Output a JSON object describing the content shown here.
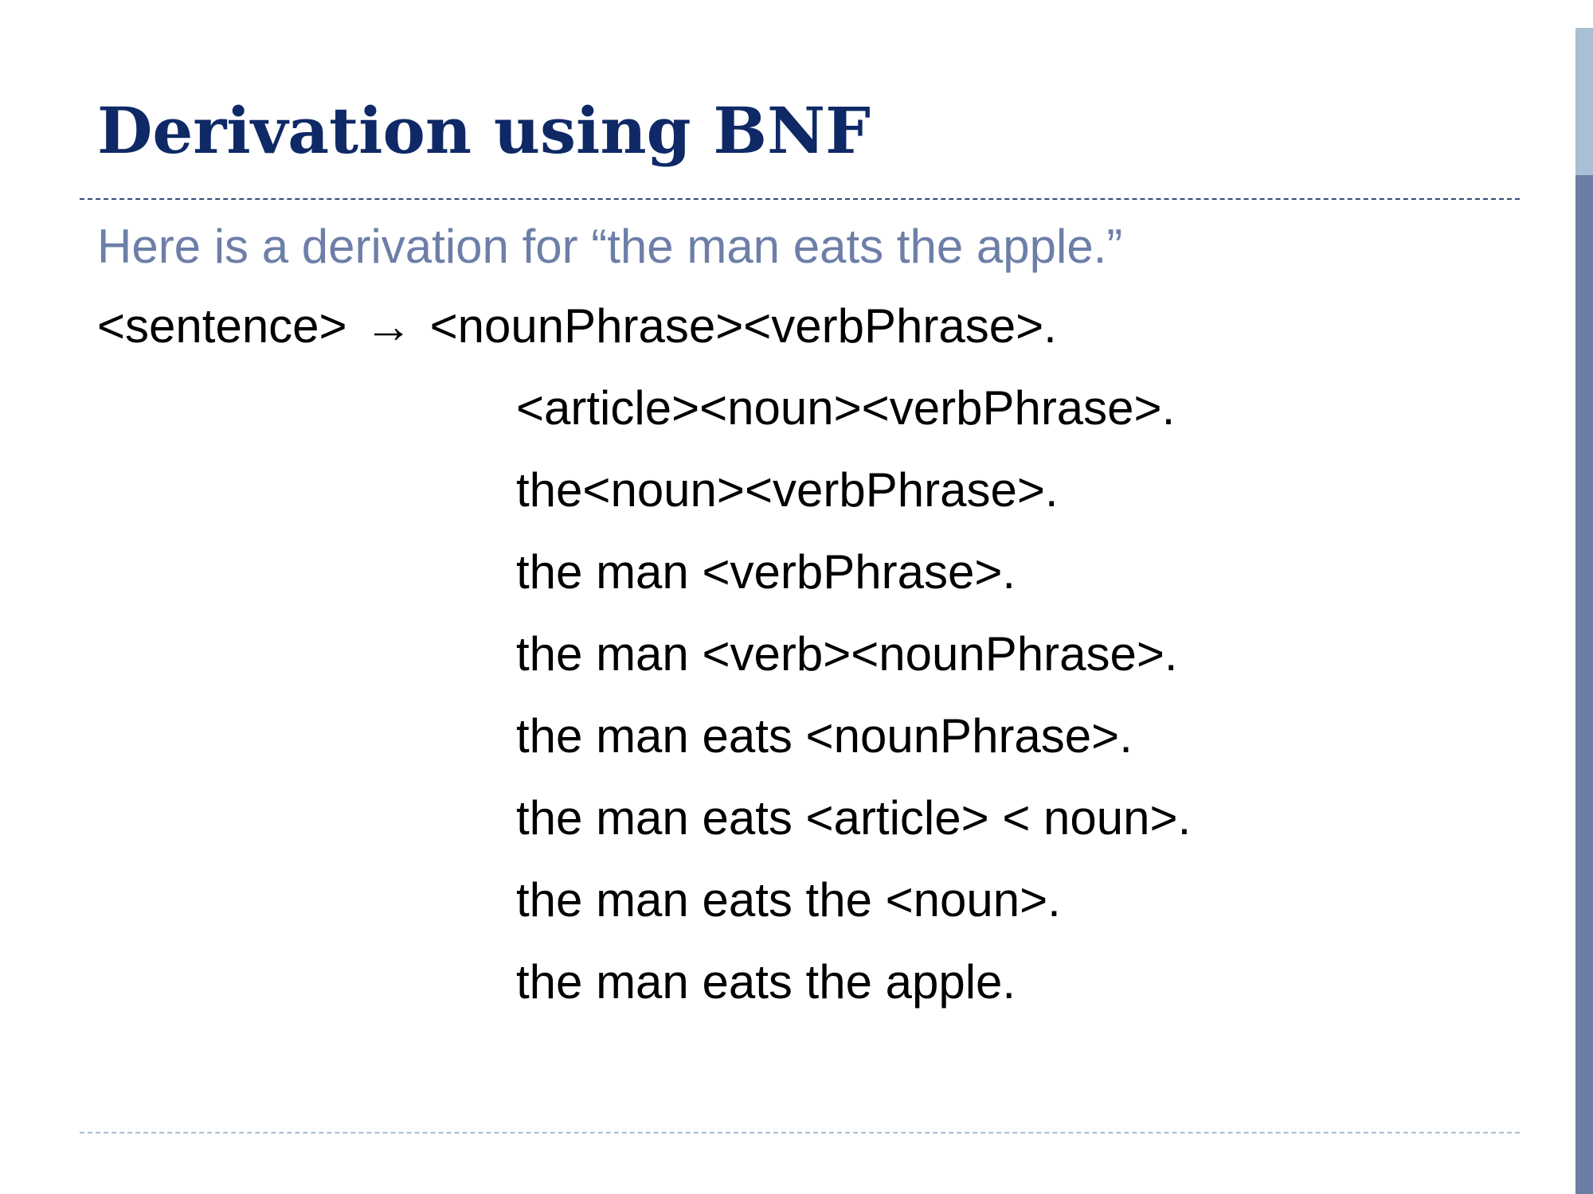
{
  "slide": {
    "title": "Derivation using BNF",
    "intro": "Here is a derivation for “the man eats the apple.”",
    "start_symbol": "<sentence>",
    "arrow": "→",
    "first_step": "<nounPhrase><verbPhrase>.",
    "steps": [
      "<article><noun><verbPhrase>.",
      "the<noun><verbPhrase>.",
      "the man <verbPhrase>.",
      "the man <verb><nounPhrase>.",
      "the man eats <nounPhrase>.",
      "the man eats <article> < noun>.",
      "the man eats the <noun>.",
      "the man eats the apple."
    ]
  },
  "theme": {
    "title_color": "#0e2966",
    "intro_color": "#6d7fa8",
    "body_color": "#000000",
    "accent_bar_dark": "#6c7ea6",
    "accent_bar_light": "#a9bfd3"
  }
}
